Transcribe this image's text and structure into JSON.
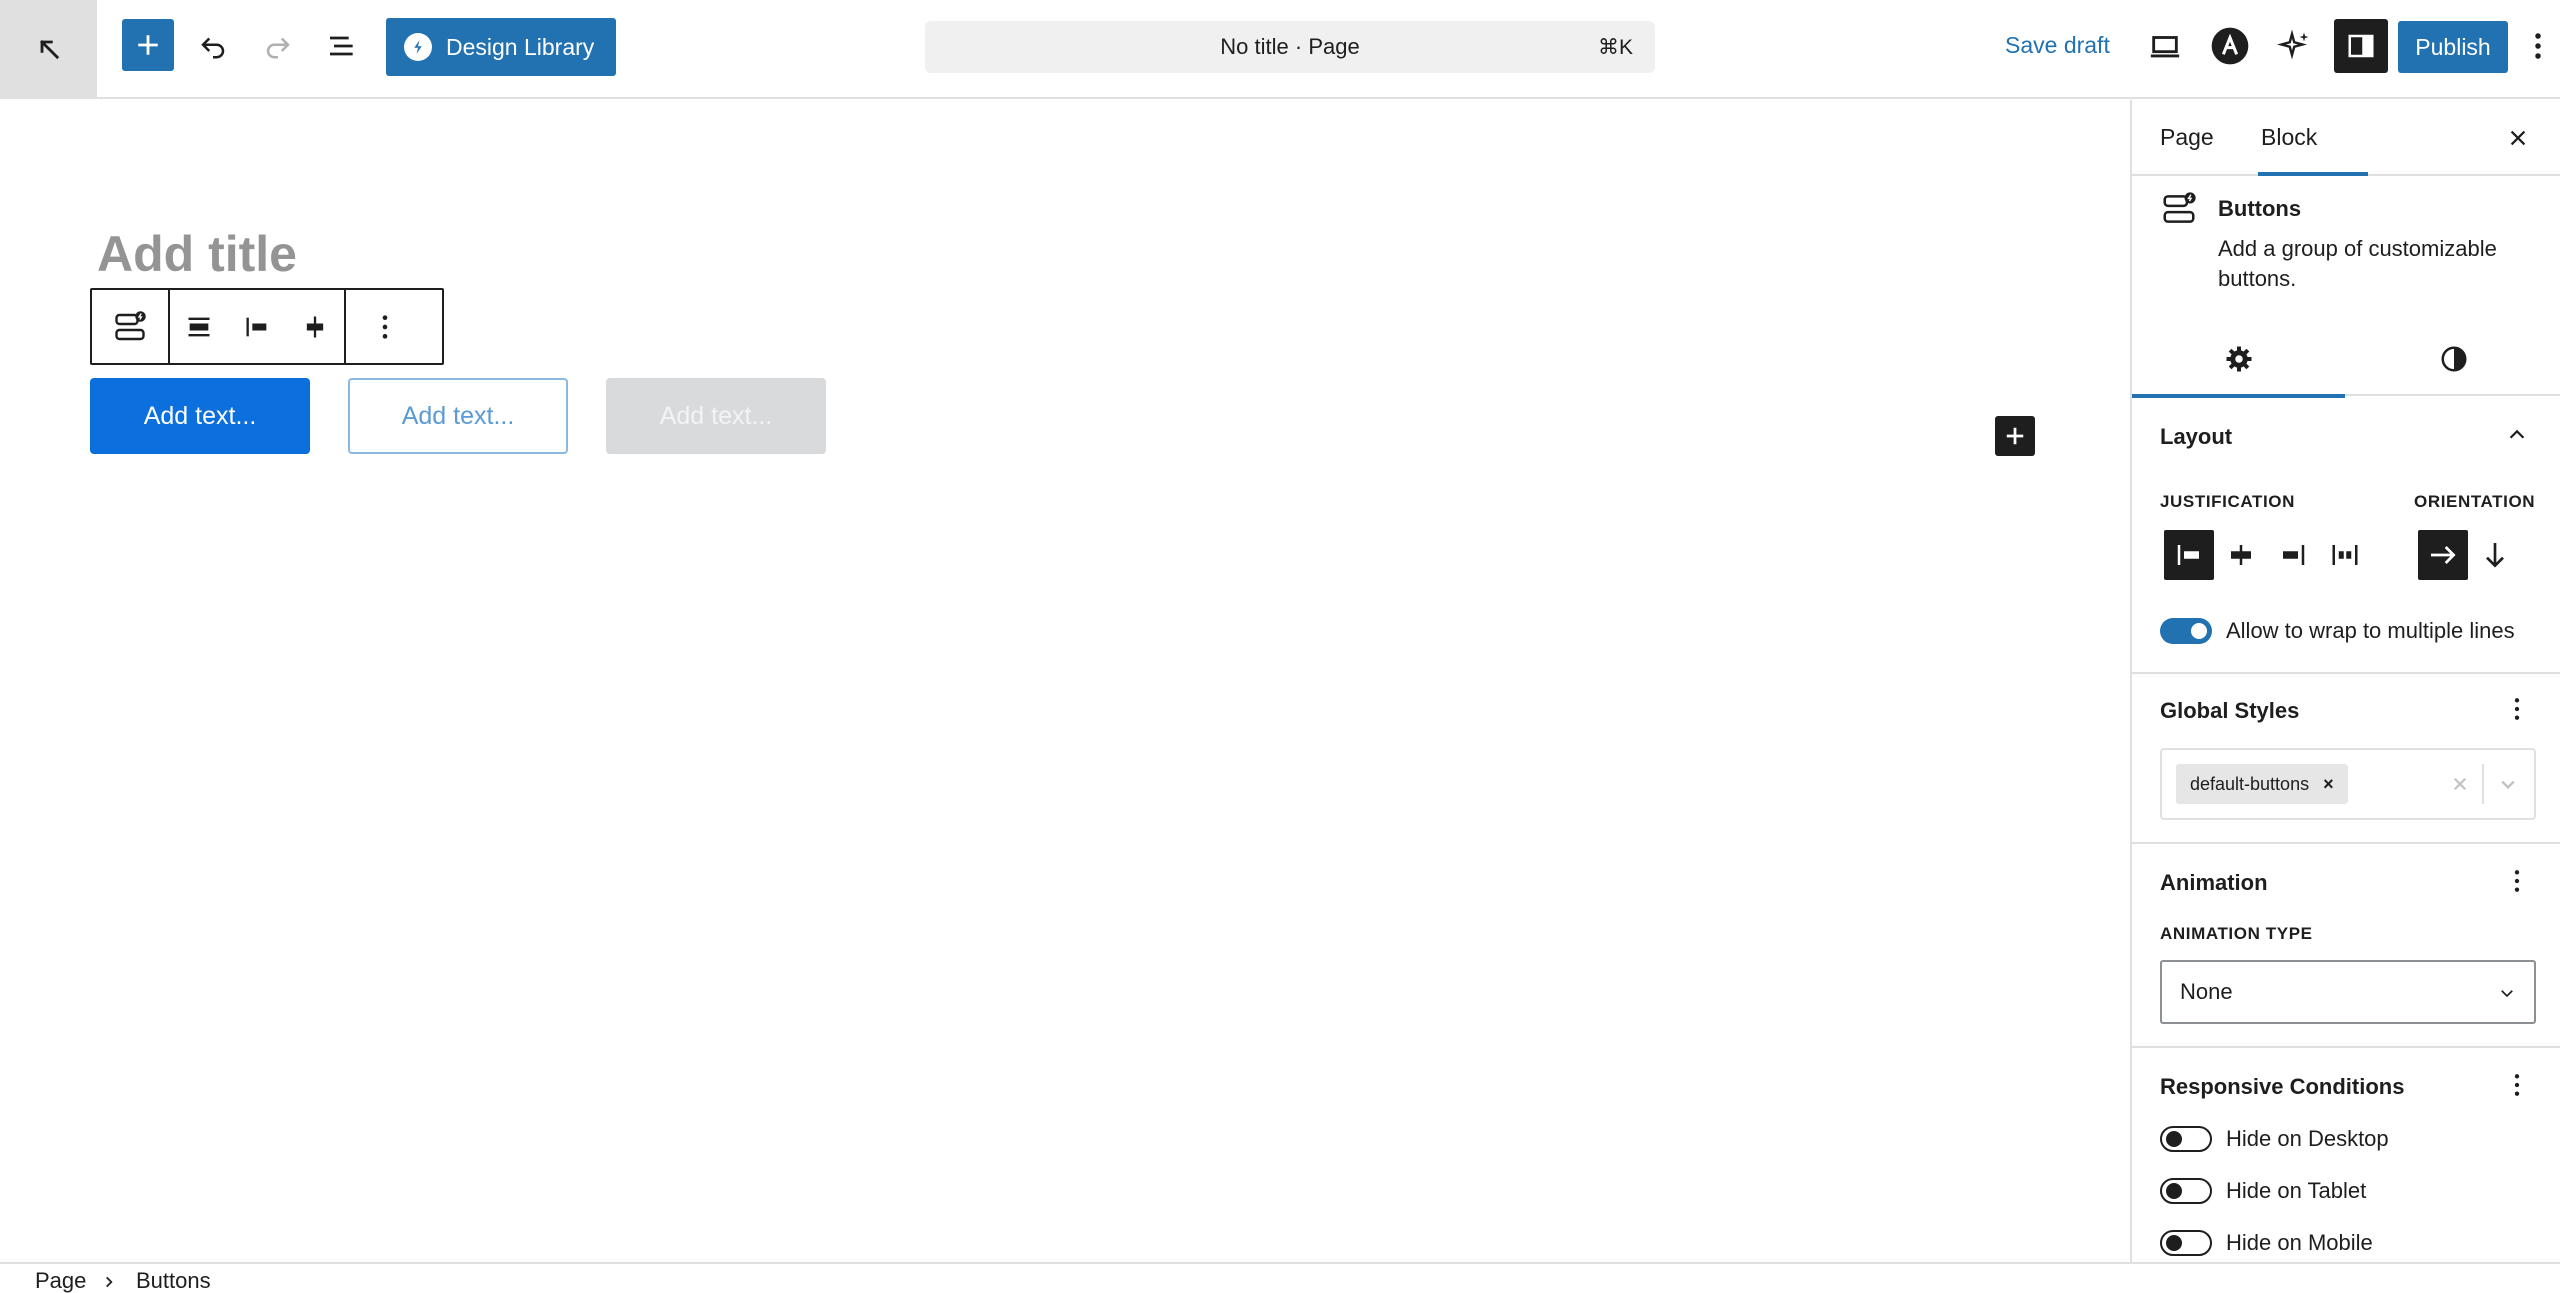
{
  "topbar": {
    "design_library_label": "Design Library",
    "document_title": "No title · Page",
    "command_shortcut": "⌘K",
    "save_draft_label": "Save draft",
    "publish_label": "Publish",
    "icons": [
      "wordpress-back-icon",
      "plus-icon",
      "undo-icon",
      "redo-icon",
      "list-view-icon",
      "stackable-logo-icon",
      "desktop-preview-icon",
      "astra-icon",
      "ai-sparkle-icon",
      "sidebar-icon",
      "more-vertical-icon"
    ]
  },
  "canvas": {
    "title_placeholder": "Add title",
    "buttons": [
      {
        "label": "Add text...",
        "style": "primary"
      },
      {
        "label": "Add text...",
        "style": "outline"
      },
      {
        "label": "Add text...",
        "style": "ghost"
      }
    ],
    "accent_color": "#0b6fde"
  },
  "sidebar": {
    "tabs": [
      {
        "label": "Page",
        "active": false
      },
      {
        "label": "Block",
        "active": true
      }
    ],
    "block": {
      "name": "Buttons",
      "description": "Add a group of customizable buttons."
    },
    "inner_tabs": [
      {
        "icon": "settings-gear-icon",
        "active": true
      },
      {
        "icon": "styles-contrast-icon",
        "active": false
      }
    ],
    "layout": {
      "title": "Layout",
      "justification_label": "Justification",
      "orientation_label": "Orientation",
      "justification_selected": "left",
      "orientation_selected": "horizontal",
      "wrap_label": "Allow to wrap to multiple lines",
      "wrap_enabled": true
    },
    "global_styles": {
      "title": "Global Styles",
      "chip": "default-buttons"
    },
    "animation": {
      "title": "Animation",
      "type_label": "Animation type",
      "type_value": "None"
    },
    "responsive": {
      "title": "Responsive Conditions",
      "items": [
        {
          "label": "Hide on Desktop",
          "enabled": false
        },
        {
          "label": "Hide on Tablet",
          "enabled": false
        },
        {
          "label": "Hide on Mobile",
          "enabled": false
        }
      ]
    }
  },
  "breadcrumb": {
    "items": [
      "Page",
      "Buttons"
    ]
  },
  "colors": {
    "brand": "#2271b1",
    "dark": "#1e1e1e",
    "border": "#e0e0e0"
  }
}
